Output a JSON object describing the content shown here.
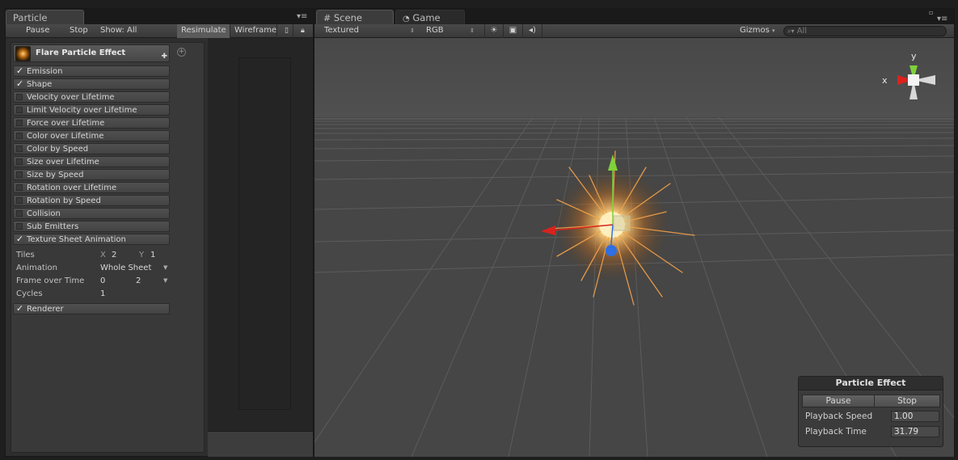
{
  "left_window": {
    "tab_title": "Particle Effect",
    "toolbar": {
      "pause": "Pause",
      "stop": "Stop",
      "show": "Show: All",
      "resimulate": "Resimulate",
      "wireframe": "Wireframe"
    },
    "effect_title": "Flare Particle Effect",
    "modules": [
      {
        "label": "Emission",
        "checked": true
      },
      {
        "label": "Shape",
        "checked": true
      },
      {
        "label": "Velocity over Lifetime",
        "checked": false
      },
      {
        "label": "Limit Velocity over Lifetime",
        "checked": false
      },
      {
        "label": "Force over Lifetime",
        "checked": false
      },
      {
        "label": "Color over Lifetime",
        "checked": false
      },
      {
        "label": "Color by Speed",
        "checked": false
      },
      {
        "label": "Size over Lifetime",
        "checked": false
      },
      {
        "label": "Size by Speed",
        "checked": false
      },
      {
        "label": "Rotation over Lifetime",
        "checked": false
      },
      {
        "label": "Rotation by Speed",
        "checked": false
      },
      {
        "label": "Collision",
        "checked": false
      },
      {
        "label": "Sub Emitters",
        "checked": false
      },
      {
        "label": "Texture Sheet Animation",
        "checked": true
      }
    ],
    "texture_sheet": {
      "tiles_label": "Tiles",
      "x_label": "X",
      "x_value": "2",
      "y_label": "Y",
      "y_value": "1",
      "animation_label": "Animation",
      "animation_value": "Whole Sheet",
      "frame_label": "Frame over Time",
      "frame_min": "0",
      "frame_max": "2",
      "cycles_label": "Cycles",
      "cycles_value": "1"
    },
    "renderer": {
      "label": "Renderer",
      "checked": true
    }
  },
  "right_window": {
    "tabs": {
      "scene": "Scene",
      "game": "Game"
    },
    "toolbar": {
      "render_mode": "Textured",
      "color_mode": "RGB",
      "gizmos": "Gizmos",
      "search_placeholder": "All"
    },
    "gizmo": {
      "y": "y",
      "x": "x"
    },
    "overlay": {
      "title": "Particle Effect",
      "pause": "Pause",
      "stop": "Stop",
      "speed_label": "Playback Speed",
      "speed_value": "1.00",
      "time_label": "Playback Time",
      "time_value": "31.79"
    }
  },
  "colors": {
    "axis_x": "#d8231d",
    "axis_y": "#7fd13a",
    "axis_z": "#2f6fe0",
    "spark": "#ffb347"
  }
}
